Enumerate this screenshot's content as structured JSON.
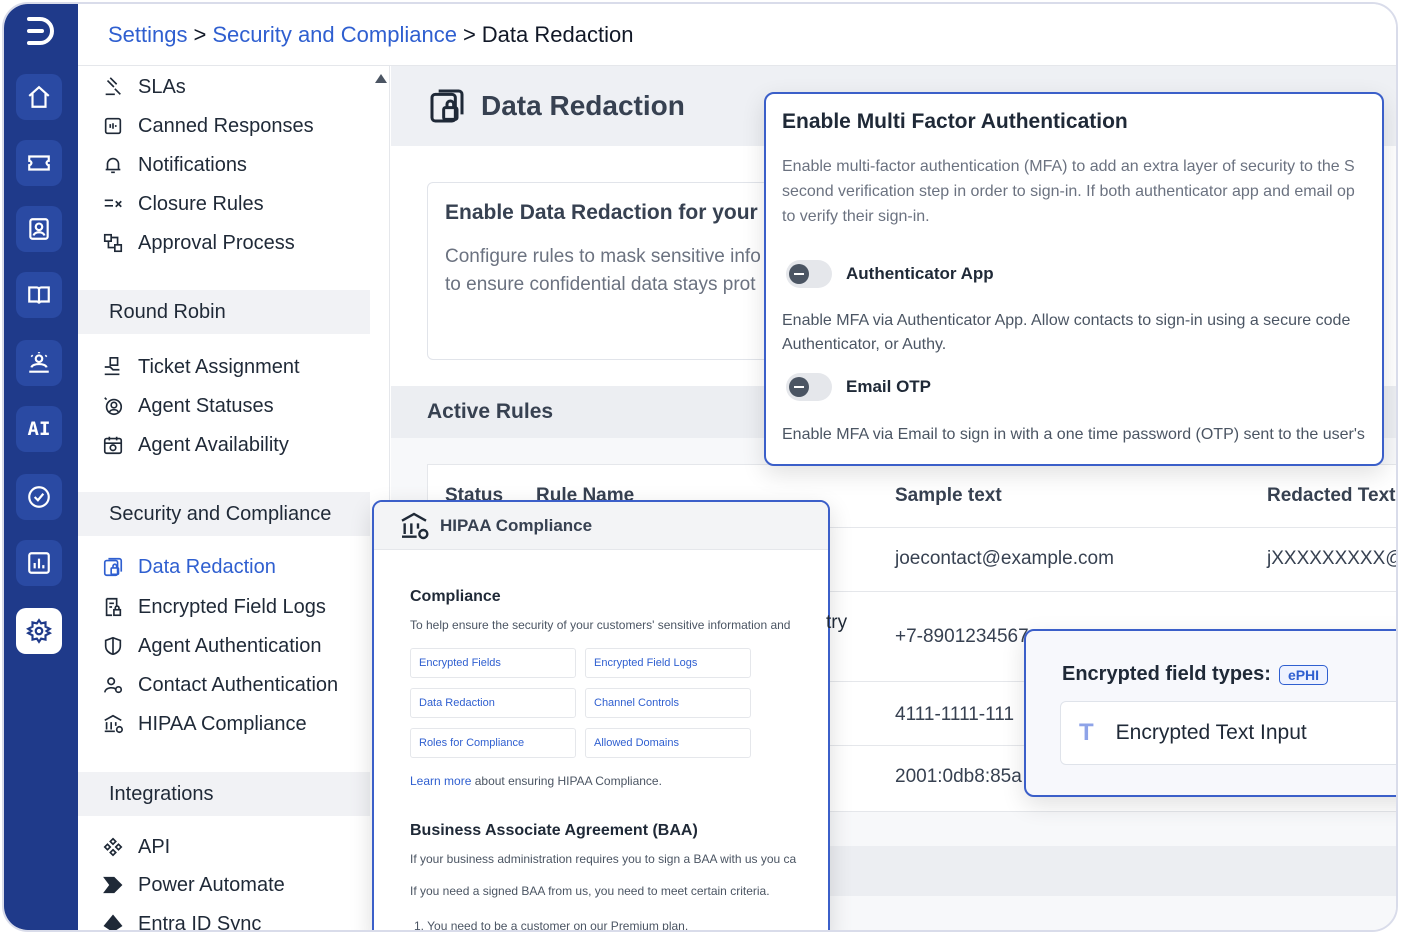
{
  "breadcrumb": {
    "settings": "Settings",
    "section": "Security and Compliance",
    "current": "Data Redaction",
    "sep1": ">",
    "sep2": ">"
  },
  "rail": {
    "ai_label": "AI",
    "icons": [
      "logo-icon",
      "home-icon",
      "ticket-icon",
      "contacts-icon",
      "knowledge-base-icon",
      "community-icon",
      "ai-icon",
      "tasks-icon",
      "reports-icon",
      "settings-icon"
    ]
  },
  "sidebar": {
    "top_items": [
      {
        "label": "SLAs"
      },
      {
        "label": "Canned Responses"
      },
      {
        "label": "Notifications"
      },
      {
        "label": "Closure Rules"
      },
      {
        "label": "Approval Process"
      }
    ],
    "round_robin": {
      "heading": "Round Robin",
      "items": [
        {
          "label": "Ticket Assignment"
        },
        {
          "label": "Agent Statuses"
        },
        {
          "label": "Agent Availability"
        }
      ]
    },
    "security": {
      "heading": "Security and Compliance",
      "items": [
        {
          "label": "Data Redaction"
        },
        {
          "label": "Encrypted Field Logs"
        },
        {
          "label": "Agent Authentication"
        },
        {
          "label": "Contact Authentication"
        },
        {
          "label": "HIPAA Compliance"
        }
      ]
    },
    "integrations": {
      "heading": "Integrations",
      "items": [
        {
          "label": "API"
        },
        {
          "label": "Power Automate"
        },
        {
          "label": "Entra ID Sync"
        }
      ]
    }
  },
  "main": {
    "title": "Data Redaction",
    "card_title": "Enable Data Redaction for your I",
    "card_line1": "Configure rules to mask sensitive info",
    "card_line2": "to ensure confidential data stays prot",
    "active_rules": "Active Rules",
    "columns": {
      "status": "Status",
      "rule_name": "Rule Name",
      "sample": "Sample text",
      "redacted": "Redacted Text"
    },
    "rows": [
      {
        "sample": "joecontact@example.com",
        "redacted": "jXXXXXXXXX@e"
      },
      {
        "sample": "+7-8901234567",
        "redacted": ""
      },
      {
        "sample": "4111-1111-111",
        "redacted": ""
      },
      {
        "sample": "2001:0db8:85a",
        "redacted": ""
      }
    ]
  },
  "mfa": {
    "title": "Enable Multi Factor Authentication",
    "desc_lines": [
      "Enable multi-factor authentication (MFA) to add an extra layer of security to the S",
      "second verification step in order to sign-in. If both authenticator app and email op",
      "to verify their sign-in."
    ],
    "authenticator": {
      "label": "Authenticator App",
      "enabled": false,
      "desc_lines": [
        "Enable MFA via Authenticator App. Allow contacts to sign-in using a secure code",
        "Authenticator, or Authy."
      ]
    },
    "email": {
      "label": "Email OTP",
      "enabled": false,
      "desc": "Enable MFA via Email to sign in with a one time password (OTP) sent to the user's"
    }
  },
  "hipaa": {
    "title": "HIPAA Compliance",
    "compliance_heading": "Compliance",
    "compliance_text": "To help ensure the security of your customers' sensitive information and",
    "compliance_overflow": "try",
    "links": [
      "Encrypted Fields",
      "Encrypted Field Logs",
      "Data Redaction",
      "Channel Controls",
      "Roles for Compliance",
      "Allowed Domains"
    ],
    "learn_more_link": "Learn more",
    "learn_more_text": "about ensuring HIPAA Compliance.",
    "baa_heading": "Business Associate Agreement (BAA)",
    "baa_text1": "If your business administration requires you to sign a BAA with us you ca",
    "baa_text2": "If you need a signed BAA from us, you need to meet certain criteria.",
    "baa_item1": "1. You need to be a customer on our Premium plan."
  },
  "encrypted": {
    "title": "Encrypted field types:",
    "badge": "ePHI",
    "field_icon": "T",
    "field_label": "Encrypted Text Input"
  },
  "colors": {
    "rail": "#1f3a8a",
    "accent": "#2f5fd0",
    "modal_border": "#3b5fc9"
  }
}
